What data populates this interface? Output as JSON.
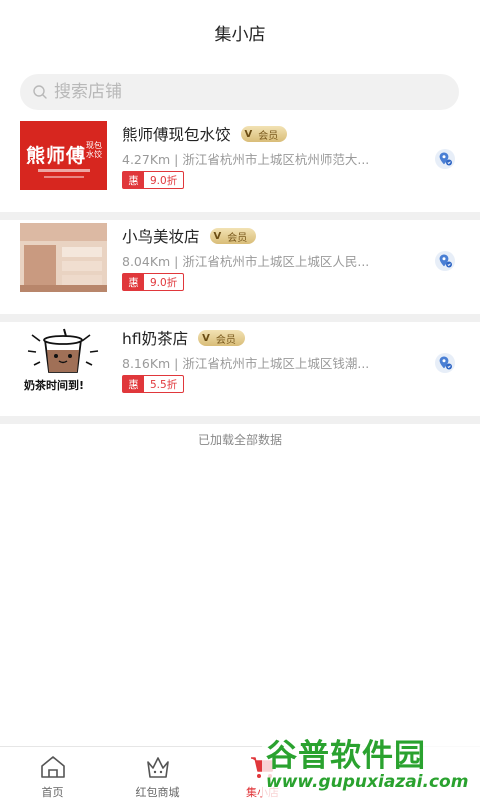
{
  "header": {
    "title": "集小店"
  },
  "search": {
    "placeholder": "搜索店铺"
  },
  "member_label": "会员",
  "stores": [
    {
      "name": "熊师傅现包水饺",
      "address": "4.27Km | 浙江省杭州市上城区杭州师范大...",
      "tag": "惠",
      "discount": "9.0折",
      "logo_text": "熊师傅",
      "logo_side": "现包水饺"
    },
    {
      "name": "小鸟美妆店",
      "address": "8.04Km | 浙江省杭州市上城区上城区人民...",
      "tag": "惠",
      "discount": "9.0折"
    },
    {
      "name": "hfl奶茶店",
      "address": "8.16Km | 浙江省杭州市上城区上城区钱潮...",
      "tag": "惠",
      "discount": "5.5折",
      "logo_caption": "奶茶时间到!"
    }
  ],
  "footer_note": "已加载全部数据",
  "tabs": [
    {
      "label": "首页",
      "icon": "home-icon"
    },
    {
      "label": "红包商城",
      "icon": "crown-icon"
    },
    {
      "label": "集小店",
      "icon": "cart-icon",
      "active": true
    }
  ],
  "watermark": {
    "title": "谷普软件园",
    "url": "www.gupuxiazai.com"
  },
  "colors": {
    "accent": "#e0373b",
    "member_gold": "#d9bd78",
    "watermark": "#2aa22f"
  }
}
